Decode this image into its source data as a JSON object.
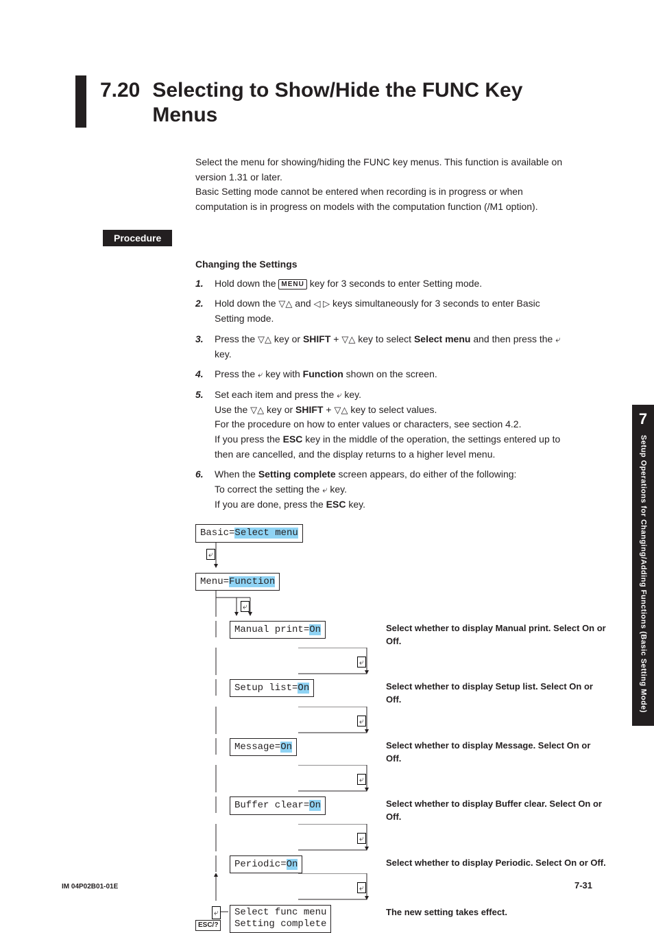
{
  "section": {
    "number": "7.20",
    "title": "Selecting to Show/Hide the FUNC Key Menus"
  },
  "intro": {
    "l1": "Select the menu for showing/hiding the FUNC key menus. This function is available on version 1.31 or later.",
    "l2": "Basic Setting mode cannot be entered when recording is in progress or when computation is in progress on models with the computation function (/M1 option)."
  },
  "procedure_label": "Procedure",
  "subhead": "Changing the Settings",
  "steps": {
    "s1a": "Hold down the ",
    "s1b": " key for 3 seconds to enter Setting mode.",
    "s2a": "Hold down the ",
    "s2b": " and ",
    "s2c": " keys simultaneously for 3 seconds to enter Basic Setting mode.",
    "s3a": "Press the ",
    "s3b": " key or ",
    "s3shift": "SHIFT",
    "s3c": " + ",
    "s3d": " key to select ",
    "s3sel": "Select menu",
    "s3e": " and then press the ",
    "s3f": " key.",
    "s4a": "Press the ",
    "s4b": " key with ",
    "s4func": "Function",
    "s4c": " shown on the screen.",
    "s5a": "Set each item and press the ",
    "s5b": " key.",
    "s5c": "Use the ",
    "s5d": " key or ",
    "s5shift": "SHIFT",
    "s5e": " + ",
    "s5f": " key to select values.",
    "s5g": "For the procedure on how to enter values or characters, see section 4.2.",
    "s5h": "If you press the ",
    "s5esc": "ESC",
    "s5i": " key in the middle of the operation, the settings entered up to then are cancelled, and the display returns to a higher level menu.",
    "s6a": "When the ",
    "s6sc": "Setting complete",
    "s6b": " screen appears, do either of the following:",
    "s6c": "To correct the setting the ",
    "s6d": " key.",
    "s6e": "If you are done, press the ",
    "s6esc": "ESC",
    "s6f": " key."
  },
  "diagram": {
    "basic_label": "Basic=",
    "basic_val": "Select menu",
    "menu_label": "Menu=",
    "menu_val": "Function",
    "r1_label": "Manual print=",
    "r1_val": "On",
    "r1_desc": "Select whether to display Manual print. Select On or Off.",
    "r2_label": "Setup list=",
    "r2_val": "On",
    "r2_desc": "Select whether to display Setup list. Select On or Off.",
    "r3_label": "Message=",
    "r3_val": "On",
    "r3_desc": "Select whether to display Message. Select On or Off.",
    "r4_label": "Buffer clear=",
    "r4_val": "On",
    "r4_desc": "Select whether to display Buffer clear. Select On or Off.",
    "r5_label": "Periodic=",
    "r5_val": "On",
    "r5_desc": "Select whether to display Periodic. Select On or Off.",
    "r6_line1": "Select func menu",
    "r6_line2": "Setting complete",
    "r6_desc": "The new setting takes effect.",
    "esc_label": "ESC/?"
  },
  "keys": {
    "menu": "MENU",
    "updown": "▽△",
    "leftright": "◁ ▷",
    "enter": "⤶"
  },
  "side": {
    "chapter": "7",
    "text": "Setup Operations for Changing/Adding Functions (Basic Setting Mode)"
  },
  "footer": {
    "doc": "IM 04P02B01-01E",
    "page": "7-31"
  }
}
